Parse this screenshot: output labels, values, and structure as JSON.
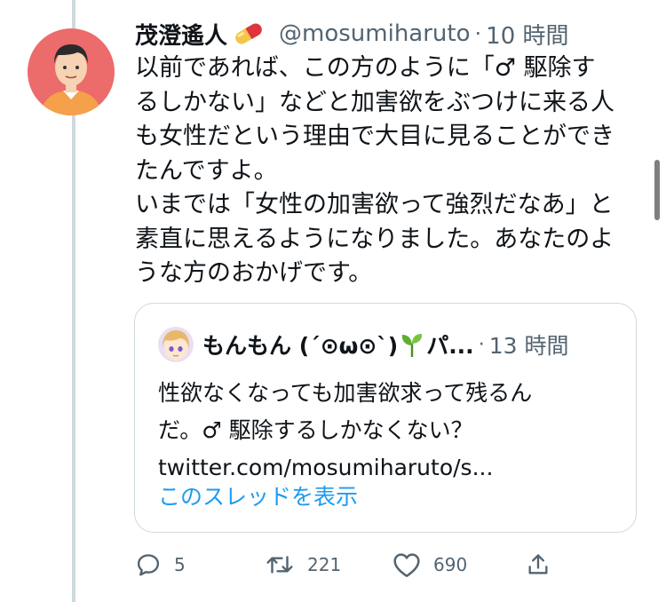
{
  "tweet": {
    "author_name": "茂澄遙人",
    "author_emoji": "pill-emoji",
    "handle": "@mosumiharuto",
    "dot": "·",
    "time": "10 時間",
    "text_lines": [
      "以前であれば、この方のように「♂ 駆除す",
      "るしかない」などと加害欲をぶつけに来る人",
      "も女性だという理由で大目に見ることができ",
      "たんですよ。",
      "いまでは「女性の加害欲って強烈だなあ」と",
      "素直に思えるようになりました。あなたのよ",
      "うな方のおかげです。"
    ]
  },
  "quote": {
    "author_name_prefix": "もんもん (´⊙ω⊙`)",
    "author_emoji": "sprout-emoji",
    "author_name_suffix": "パ...",
    "dot": "·",
    "time": "13 時間",
    "text_lines": [
      "性欲なくなっても加害欲求って残るん",
      "だ。♂ 駆除するしかなくない？",
      "twitter.com/mosumiharuto/s..."
    ],
    "thread_link": "このスレッドを表示"
  },
  "actions": {
    "reply_count": "5",
    "retweet_count": "221",
    "like_count": "690"
  },
  "colors": {
    "text": "#0f1419",
    "secondary": "#536471",
    "link": "#1d9bf0",
    "border": "#cfd9de"
  }
}
